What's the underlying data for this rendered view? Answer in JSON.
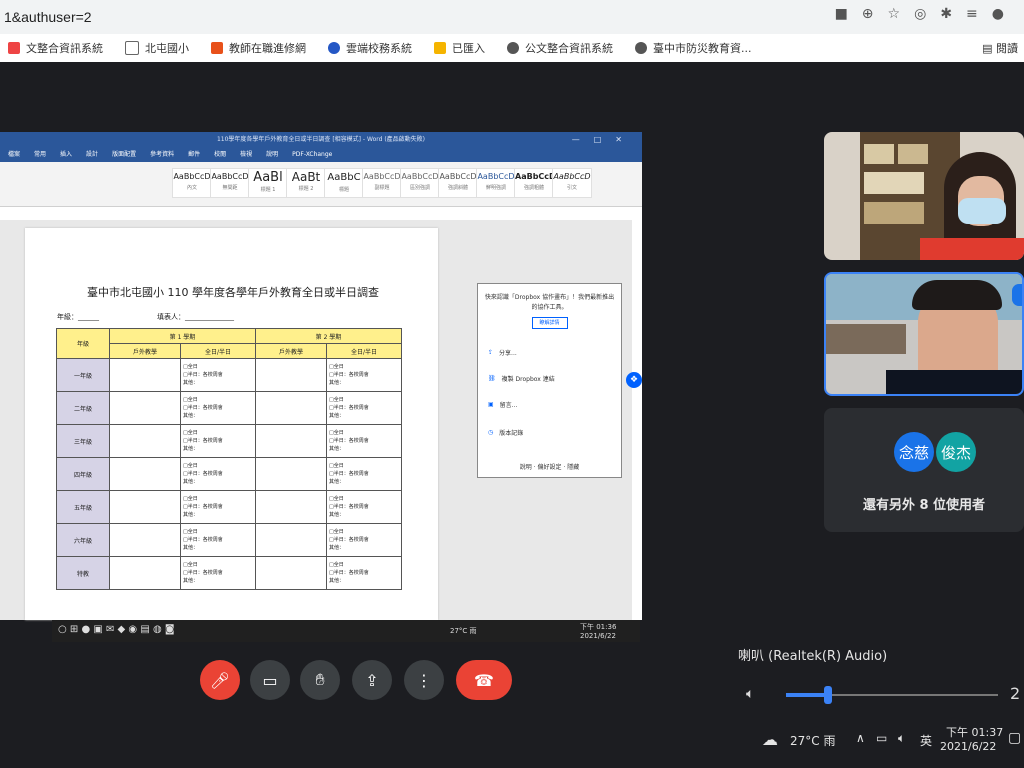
{
  "browser": {
    "url_text": "1&authuser=2",
    "bookmarks": [
      "文整合資訊系統",
      "北屯國小",
      "教師在職進修網",
      "雲端校務系統",
      "已匯入",
      "公文整合資訊系統",
      "臺中市防災教育資..."
    ],
    "bookmarks_right": "閱讀"
  },
  "word": {
    "title": "110學年度各學年戶外教育全日或半日調查 [相容模式] - Word (產品啟動失敗)",
    "menu": [
      "檔案",
      "常用",
      "插入",
      "設計",
      "版面配置",
      "參考資料",
      "郵件",
      "校閱",
      "檢視",
      "說明",
      "PDF-XChange"
    ],
    "styles": [
      {
        "sample": "AaBbCcD",
        "name": "內文"
      },
      {
        "sample": "AaBbCcD",
        "name": "無間距"
      },
      {
        "sample": "AaBl",
        "name": "標題 1"
      },
      {
        "sample": "AaBt",
        "name": "標題 2"
      },
      {
        "sample": "AaBbC",
        "name": "標題"
      },
      {
        "sample": "AaBbCcD",
        "name": "副標題"
      },
      {
        "sample": "AaBbCcD",
        "name": "區別強調"
      },
      {
        "sample": "AaBbCcD",
        "name": "強調斜體"
      },
      {
        "sample": "AaBbCcD",
        "name": "鮮明強調"
      },
      {
        "sample": "AaBbCcD",
        "name": "強調粗體"
      },
      {
        "sample": "AaBbCcD",
        "name": "引文"
      }
    ],
    "doc_title": "臺中市北屯國小 110 學年度各學年戶外教育全日或半日調查",
    "grade_field": "年級：______",
    "filler_field": "填表人：______________",
    "table": {
      "head1": "年級",
      "sem1": "第 1 學期",
      "sem2": "第 2 學期",
      "sub_count": "戶外教學",
      "sub_type": "全日/半日",
      "option_lines": [
        "□全日",
        "□半日：各校周會",
        "其他："
      ],
      "rows": [
        "一年級",
        "二年級",
        "三年級",
        "四年級",
        "五年級",
        "六年級",
        "特教"
      ]
    },
    "dropbox": {
      "intro": "快來認識「Dropbox 協作畫布」！我們最新推出的協作工具。",
      "try_btn": "瞭解詳情",
      "items": [
        "分享...",
        "複製 Dropbox 連結",
        "留言...",
        "版本記錄"
      ],
      "footer": "說明 · 偏好設定 · 隱藏"
    },
    "taskbar_weather": "27°C 雨",
    "taskbar_time": "下午 01:36",
    "taskbar_date": "2021/6/22"
  },
  "participants": {
    "avatars": [
      "念慈",
      "俊杰"
    ],
    "more_text": "還有另外 8 位使用者",
    "colors": [
      "#1a73e8",
      "#12a3a3"
    ]
  },
  "controls": {
    "mic_icon": "mic-off-icon",
    "end_icon": "phone-hangup-icon"
  },
  "volume": {
    "device_label": "喇叭 (Realtek(R) Audio)",
    "level_text": "2",
    "level_fraction": 0.2
  },
  "tray": {
    "weather": "27°C 雨",
    "ime": "英",
    "time": "下午 01:37",
    "date": "2021/6/22"
  }
}
